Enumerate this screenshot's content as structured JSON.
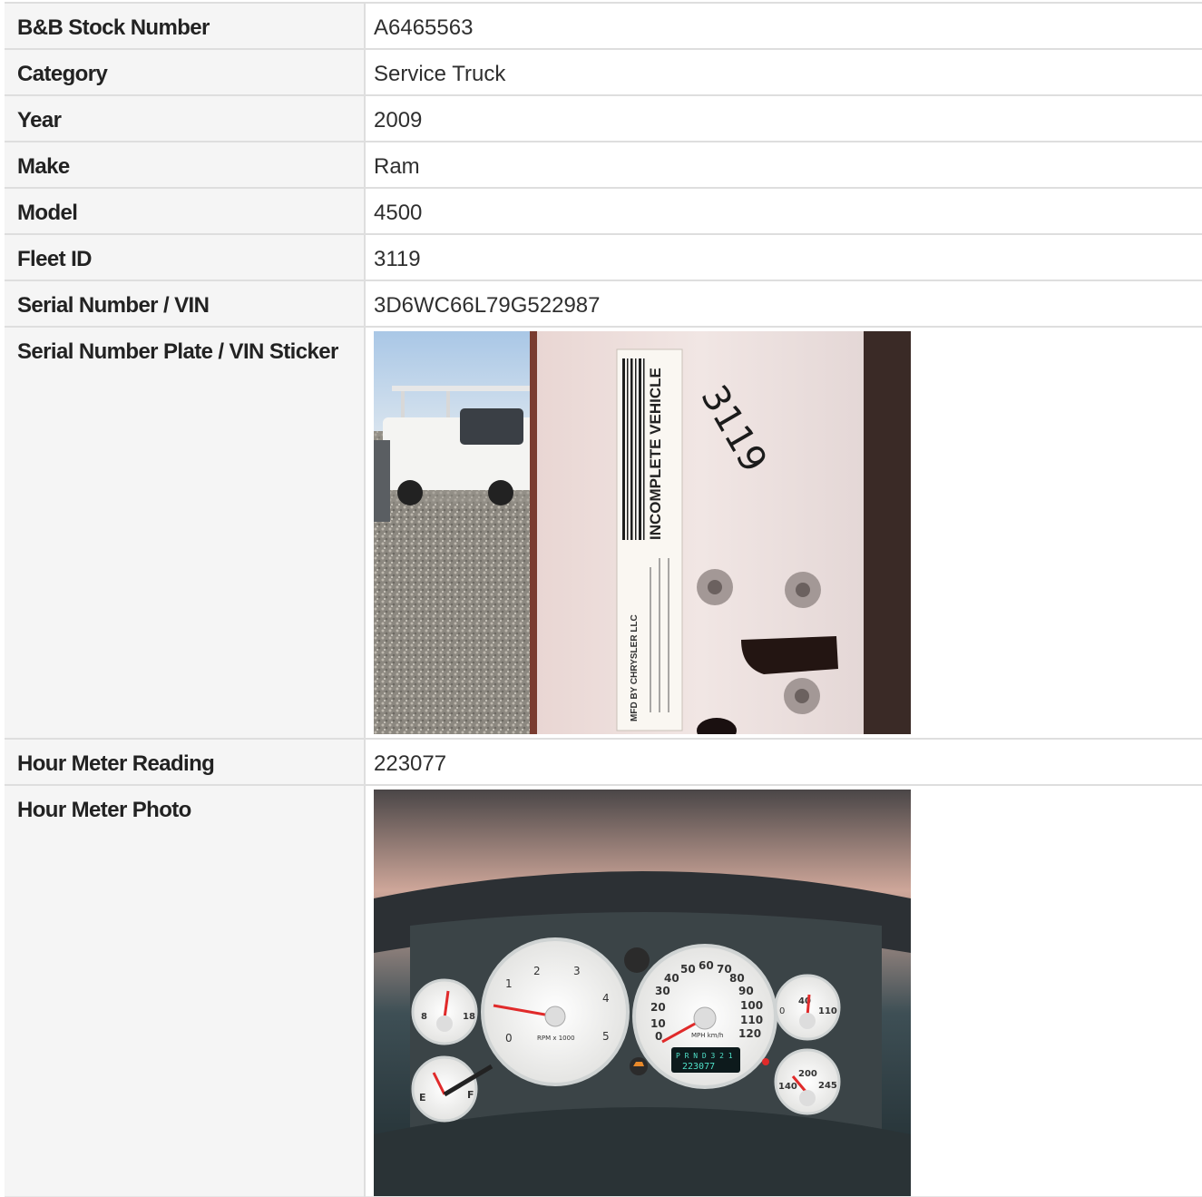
{
  "rows": [
    {
      "label": "B&B Stock Number",
      "value": "A6465563"
    },
    {
      "label": "Category",
      "value": "Service Truck"
    },
    {
      "label": "Year",
      "value": "2009"
    },
    {
      "label": "Make",
      "value": "Ram"
    },
    {
      "label": "Model",
      "value": "4500"
    },
    {
      "label": "Fleet ID",
      "value": "3119"
    },
    {
      "label": "Serial Number / VIN",
      "value": "3D6WC66L79G522987"
    }
  ],
  "vin_photo": {
    "label": "Serial Number Plate / VIN Sticker",
    "sticker_heading": "INCOMPLETE VEHICLE",
    "manufacturer": "MFD BY CHRYSLER LLC",
    "handwritten_number": "3119"
  },
  "hour_meter": {
    "label": "Hour Meter Reading",
    "value": "223077"
  },
  "hour_photo": {
    "label": "Hour Meter Photo",
    "odometer_display": "223077",
    "gear_display": "P R N D 3 2 1",
    "tach_ticks": [
      "0",
      "1",
      "2",
      "3",
      "4",
      "5"
    ],
    "tach_caption": "RPM x 1000",
    "speed_ticks": [
      "0",
      "10",
      "20",
      "30",
      "40",
      "50",
      "60",
      "70",
      "80",
      "90",
      "100",
      "110",
      "120"
    ],
    "speed_caption": "MPH km/h",
    "oil_ticks": [
      "0",
      "40",
      "110"
    ],
    "temp_ticks": [
      "140",
      "200",
      "245"
    ],
    "volt_ticks": [
      "8",
      "18"
    ],
    "fuel_ticks": [
      "E",
      "F"
    ]
  },
  "colors": {
    "label_bg": "#f5f5f5",
    "border": "#dedede",
    "needle": "#e02a2a"
  }
}
